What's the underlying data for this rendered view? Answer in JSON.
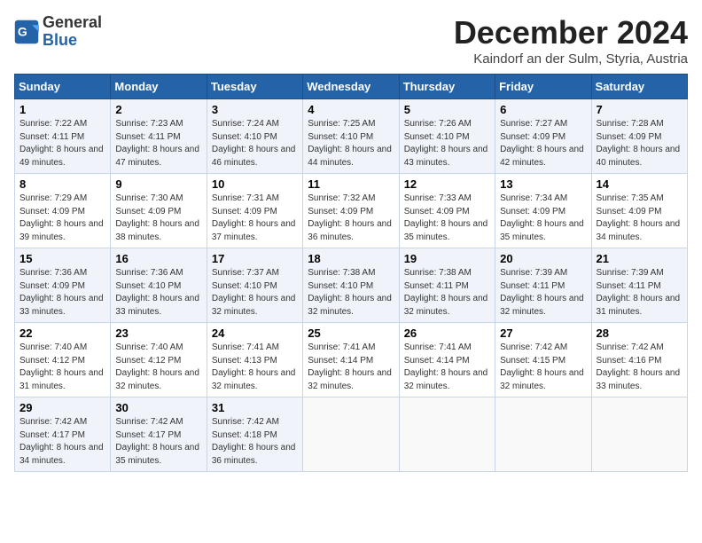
{
  "header": {
    "logo_general": "General",
    "logo_blue": "Blue",
    "month_title": "December 2024",
    "location": "Kaindorf an der Sulm, Styria, Austria"
  },
  "days_of_week": [
    "Sunday",
    "Monday",
    "Tuesday",
    "Wednesday",
    "Thursday",
    "Friday",
    "Saturday"
  ],
  "weeks": [
    [
      {
        "day": "1",
        "sunrise": "7:22 AM",
        "sunset": "4:11 PM",
        "daylight": "8 hours and 49 minutes."
      },
      {
        "day": "2",
        "sunrise": "7:23 AM",
        "sunset": "4:11 PM",
        "daylight": "8 hours and 47 minutes."
      },
      {
        "day": "3",
        "sunrise": "7:24 AM",
        "sunset": "4:10 PM",
        "daylight": "8 hours and 46 minutes."
      },
      {
        "day": "4",
        "sunrise": "7:25 AM",
        "sunset": "4:10 PM",
        "daylight": "8 hours and 44 minutes."
      },
      {
        "day": "5",
        "sunrise": "7:26 AM",
        "sunset": "4:10 PM",
        "daylight": "8 hours and 43 minutes."
      },
      {
        "day": "6",
        "sunrise": "7:27 AM",
        "sunset": "4:09 PM",
        "daylight": "8 hours and 42 minutes."
      },
      {
        "day": "7",
        "sunrise": "7:28 AM",
        "sunset": "4:09 PM",
        "daylight": "8 hours and 40 minutes."
      }
    ],
    [
      {
        "day": "8",
        "sunrise": "7:29 AM",
        "sunset": "4:09 PM",
        "daylight": "8 hours and 39 minutes."
      },
      {
        "day": "9",
        "sunrise": "7:30 AM",
        "sunset": "4:09 PM",
        "daylight": "8 hours and 38 minutes."
      },
      {
        "day": "10",
        "sunrise": "7:31 AM",
        "sunset": "4:09 PM",
        "daylight": "8 hours and 37 minutes."
      },
      {
        "day": "11",
        "sunrise": "7:32 AM",
        "sunset": "4:09 PM",
        "daylight": "8 hours and 36 minutes."
      },
      {
        "day": "12",
        "sunrise": "7:33 AM",
        "sunset": "4:09 PM",
        "daylight": "8 hours and 35 minutes."
      },
      {
        "day": "13",
        "sunrise": "7:34 AM",
        "sunset": "4:09 PM",
        "daylight": "8 hours and 35 minutes."
      },
      {
        "day": "14",
        "sunrise": "7:35 AM",
        "sunset": "4:09 PM",
        "daylight": "8 hours and 34 minutes."
      }
    ],
    [
      {
        "day": "15",
        "sunrise": "7:36 AM",
        "sunset": "4:09 PM",
        "daylight": "8 hours and 33 minutes."
      },
      {
        "day": "16",
        "sunrise": "7:36 AM",
        "sunset": "4:10 PM",
        "daylight": "8 hours and 33 minutes."
      },
      {
        "day": "17",
        "sunrise": "7:37 AM",
        "sunset": "4:10 PM",
        "daylight": "8 hours and 32 minutes."
      },
      {
        "day": "18",
        "sunrise": "7:38 AM",
        "sunset": "4:10 PM",
        "daylight": "8 hours and 32 minutes."
      },
      {
        "day": "19",
        "sunrise": "7:38 AM",
        "sunset": "4:11 PM",
        "daylight": "8 hours and 32 minutes."
      },
      {
        "day": "20",
        "sunrise": "7:39 AM",
        "sunset": "4:11 PM",
        "daylight": "8 hours and 32 minutes."
      },
      {
        "day": "21",
        "sunrise": "7:39 AM",
        "sunset": "4:11 PM",
        "daylight": "8 hours and 31 minutes."
      }
    ],
    [
      {
        "day": "22",
        "sunrise": "7:40 AM",
        "sunset": "4:12 PM",
        "daylight": "8 hours and 31 minutes."
      },
      {
        "day": "23",
        "sunrise": "7:40 AM",
        "sunset": "4:12 PM",
        "daylight": "8 hours and 32 minutes."
      },
      {
        "day": "24",
        "sunrise": "7:41 AM",
        "sunset": "4:13 PM",
        "daylight": "8 hours and 32 minutes."
      },
      {
        "day": "25",
        "sunrise": "7:41 AM",
        "sunset": "4:14 PM",
        "daylight": "8 hours and 32 minutes."
      },
      {
        "day": "26",
        "sunrise": "7:41 AM",
        "sunset": "4:14 PM",
        "daylight": "8 hours and 32 minutes."
      },
      {
        "day": "27",
        "sunrise": "7:42 AM",
        "sunset": "4:15 PM",
        "daylight": "8 hours and 32 minutes."
      },
      {
        "day": "28",
        "sunrise": "7:42 AM",
        "sunset": "4:16 PM",
        "daylight": "8 hours and 33 minutes."
      }
    ],
    [
      {
        "day": "29",
        "sunrise": "7:42 AM",
        "sunset": "4:17 PM",
        "daylight": "8 hours and 34 minutes."
      },
      {
        "day": "30",
        "sunrise": "7:42 AM",
        "sunset": "4:17 PM",
        "daylight": "8 hours and 35 minutes."
      },
      {
        "day": "31",
        "sunrise": "7:42 AM",
        "sunset": "4:18 PM",
        "daylight": "8 hours and 36 minutes."
      },
      null,
      null,
      null,
      null
    ]
  ],
  "labels": {
    "sunrise": "Sunrise:",
    "sunset": "Sunset:",
    "daylight": "Daylight:"
  }
}
